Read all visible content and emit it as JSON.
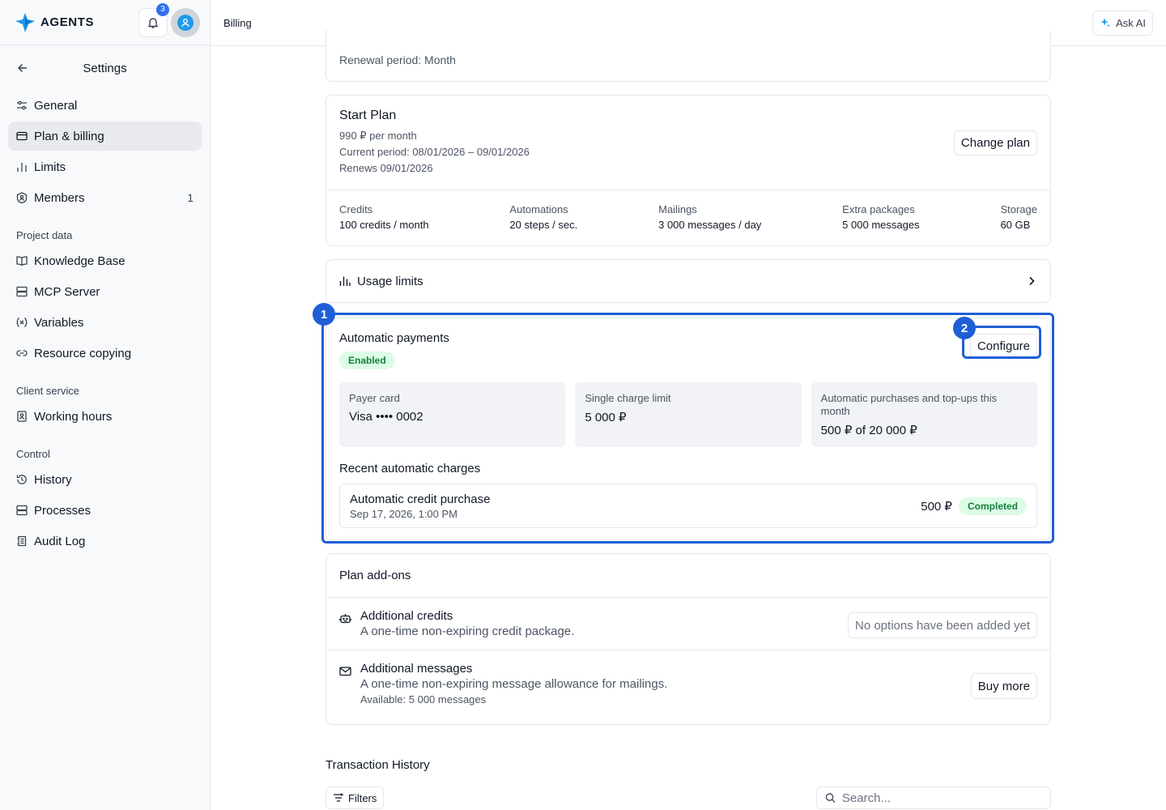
{
  "brand": {
    "name": "AGENTS",
    "notification_count": "3"
  },
  "topbar": {
    "title": "Billing",
    "ask_ai_label": "Ask AI"
  },
  "sidebar": {
    "title": "Settings",
    "items": [
      {
        "label": "General",
        "icon": "sliders-icon"
      },
      {
        "label": "Plan & billing",
        "icon": "credit-card-icon",
        "active": true
      },
      {
        "label": "Limits",
        "icon": "bar-chart-icon"
      },
      {
        "label": "Members",
        "icon": "users-icon",
        "count": "1"
      }
    ],
    "sections": [
      {
        "title": "Project data",
        "items": [
          {
            "label": "Knowledge Base",
            "icon": "book-icon"
          },
          {
            "label": "MCP Server",
            "icon": "server-icon"
          },
          {
            "label": "Variables",
            "icon": "variable-icon"
          },
          {
            "label": "Resource copying",
            "icon": "link-icon"
          }
        ]
      },
      {
        "title": "Client service",
        "items": [
          {
            "label": "Working hours",
            "icon": "contact-icon"
          }
        ]
      },
      {
        "title": "Control",
        "items": [
          {
            "label": "History",
            "icon": "history-icon"
          },
          {
            "label": "Processes",
            "icon": "server-icon"
          },
          {
            "label": "Audit Log",
            "icon": "log-icon"
          }
        ]
      }
    ]
  },
  "renewal": {
    "text": "Renewal period: Month"
  },
  "plan": {
    "name": "Start Plan",
    "price": "990 ₽ per month",
    "current_period": "Current period: 08/01/2026 – 09/01/2026",
    "renews": "Renews 09/01/2026",
    "change_label": "Change plan",
    "stats": [
      {
        "label": "Credits",
        "value": "100 credits / month"
      },
      {
        "label": "Automations",
        "value": "20 steps / sec."
      },
      {
        "label": "Mailings",
        "value": "3 000 messages / day"
      },
      {
        "label": "Extra packages",
        "value": "5 000 messages"
      },
      {
        "label": "Storage",
        "value": "60 GB"
      }
    ]
  },
  "usage": {
    "label": "Usage limits"
  },
  "autopay": {
    "title": "Automatic payments",
    "status": "Enabled",
    "configure_label": "Configure",
    "tiles": [
      {
        "label": "Payer card",
        "value": "Visa •••• 0002"
      },
      {
        "label": "Single charge limit",
        "value": "5 000 ₽"
      },
      {
        "label": "Automatic purchases and top-ups this month",
        "value": "500 ₽ of 20 000 ₽"
      }
    ],
    "recent_title": "Recent automatic charges",
    "charge": {
      "name": "Automatic credit purchase",
      "date": "Sep 17, 2026, 1:00 PM",
      "amount": "500 ₽",
      "status": "Completed"
    }
  },
  "callouts": {
    "first": "1",
    "second": "2"
  },
  "addons": {
    "title": "Plan add-ons",
    "credits": {
      "title": "Additional credits",
      "desc": "A one-time non-expiring credit package.",
      "action": "No options have been added yet"
    },
    "messages": {
      "title": "Additional messages",
      "desc": "A one-time non-expiring message allowance for mailings.",
      "available": "Available: 5 000 messages",
      "action": "Buy more"
    }
  },
  "transactions": {
    "title": "Transaction History",
    "filters_label": "Filters",
    "search_placeholder": "Search..."
  },
  "colors": {
    "accent": "#1f5fd6",
    "success_bg": "#dcfce7",
    "success_text": "#15803d",
    "brand": "#1e9ae8"
  }
}
